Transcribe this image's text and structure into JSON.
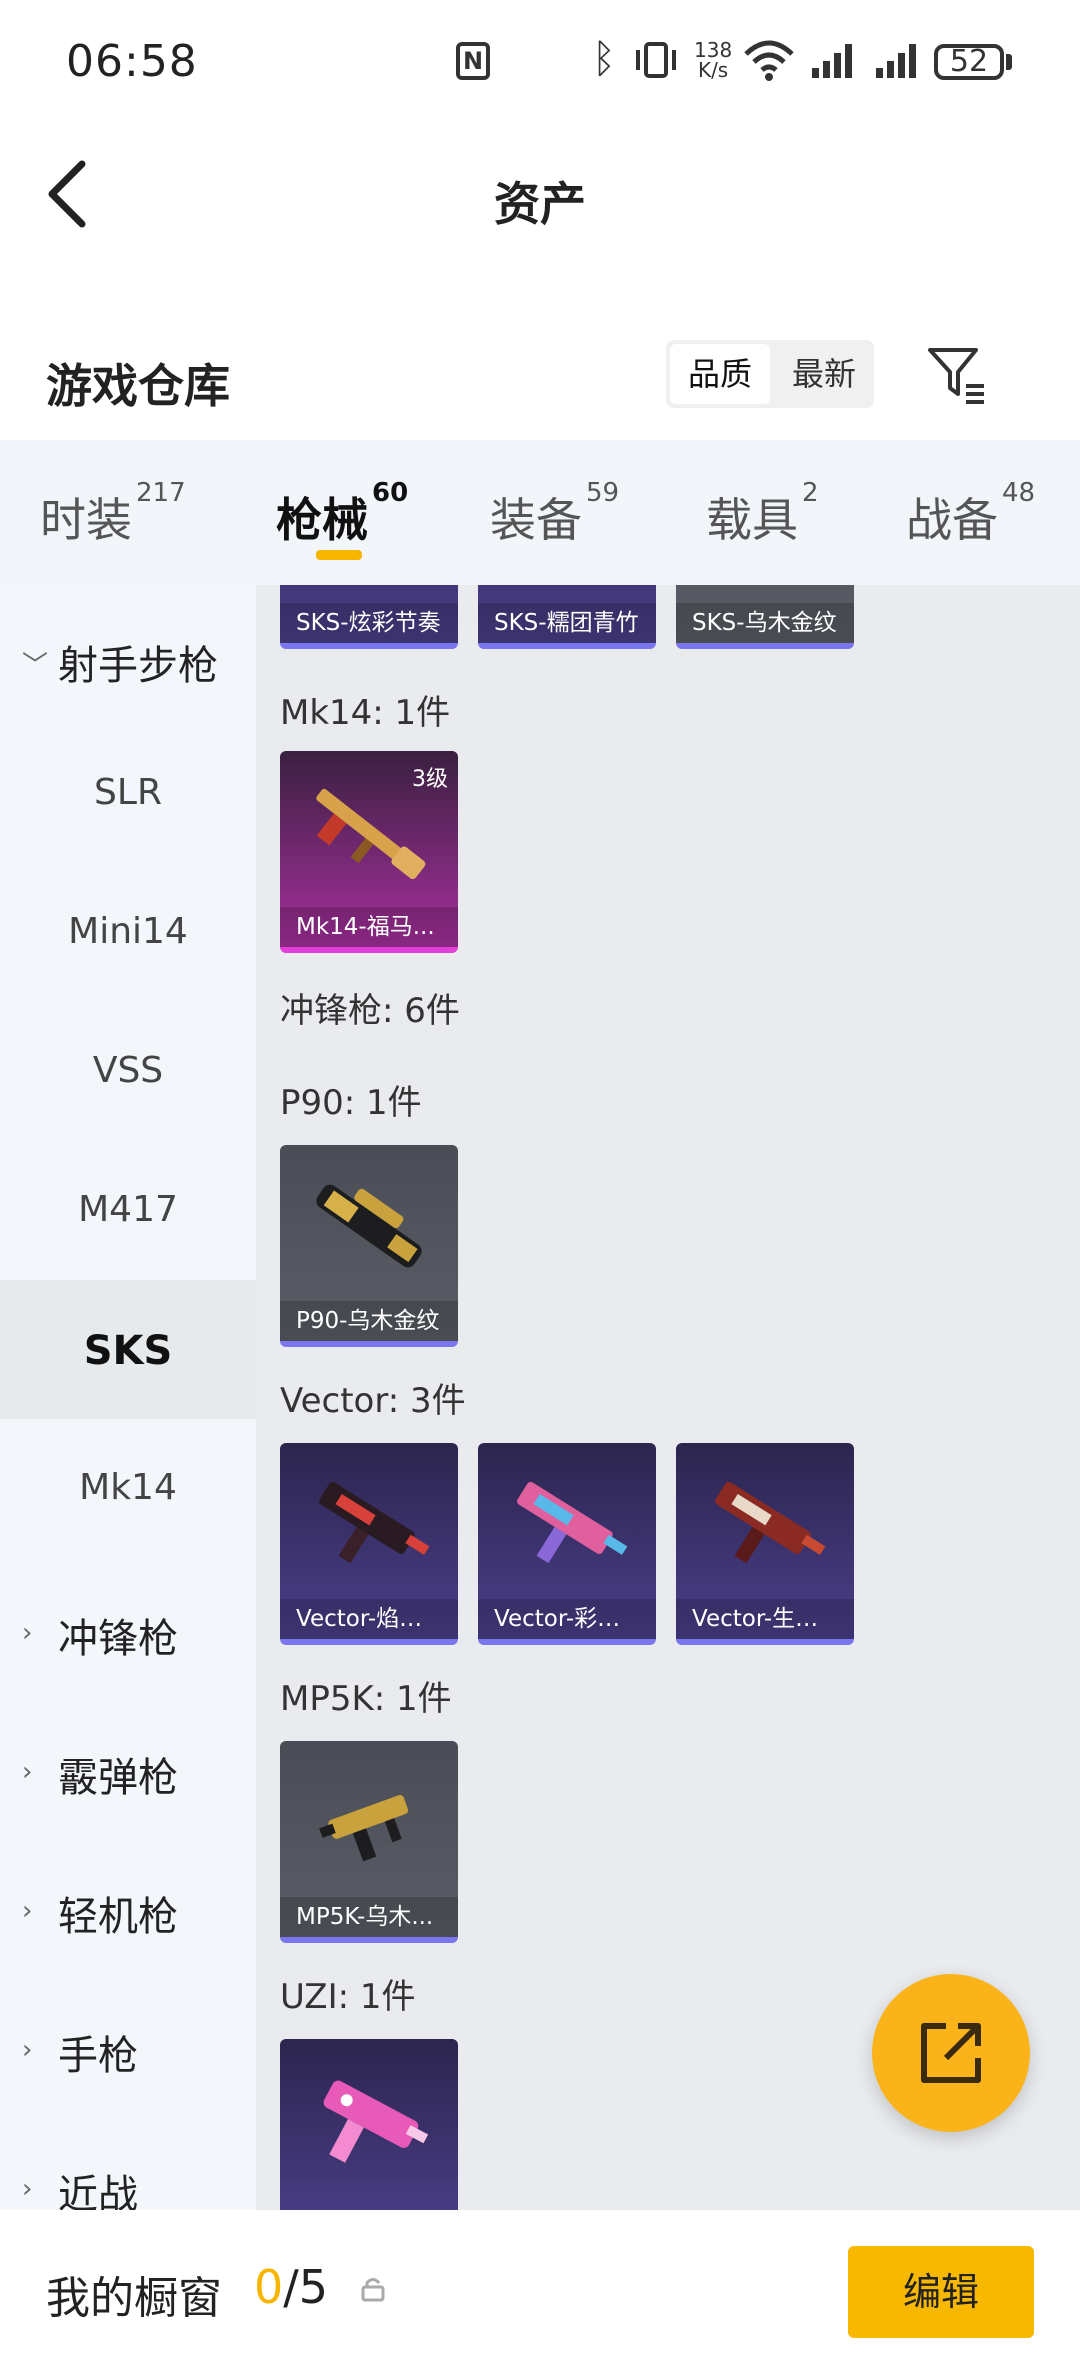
{
  "status_bar": {
    "time": "06:58",
    "nfc": "N",
    "net_speed_value": "138",
    "net_speed_unit": "K/s",
    "battery": "52"
  },
  "nav": {
    "title": "资产"
  },
  "section": {
    "title": "游戏仓库",
    "sort_options": [
      "品质",
      "最新"
    ],
    "sort_selected": "品质"
  },
  "tabs": [
    {
      "label": "时装",
      "count": "217"
    },
    {
      "label": "枪械",
      "count": "60",
      "active": true
    },
    {
      "label": "装备",
      "count": "59"
    },
    {
      "label": "载具",
      "count": "2"
    },
    {
      "label": "战备",
      "count": "48"
    }
  ],
  "sidebar": {
    "items": [
      {
        "label": "射手步枪",
        "type": "category",
        "expanded": true
      },
      {
        "label": "SLR"
      },
      {
        "label": "Mini14"
      },
      {
        "label": "VSS"
      },
      {
        "label": "M417"
      },
      {
        "label": "SKS",
        "active": true
      },
      {
        "label": "Mk14"
      },
      {
        "label": "冲锋枪",
        "type": "category"
      },
      {
        "label": "霰弹枪",
        "type": "category"
      },
      {
        "label": "轻机枪",
        "type": "category"
      },
      {
        "label": "手枪",
        "type": "category"
      },
      {
        "label": "近战",
        "type": "category"
      }
    ]
  },
  "content": {
    "sks_cards": [
      "SKS-炫彩节奏",
      "SKS-糯团青竹",
      "SKS-乌木金纹"
    ],
    "mk14_header": "Mk14: 1件",
    "mk14_cards": [
      {
        "name": "Mk14-福马...",
        "level": "3级"
      }
    ],
    "smg_header": "冲锋枪: 6件",
    "p90_header": "P90: 1件",
    "p90_cards": [
      "P90-乌木金纹"
    ],
    "vector_header": "Vector: 3件",
    "vector_cards": [
      "Vector-焰鹰...",
      "Vector-彩虹...",
      "Vector-生命..."
    ],
    "mp5k_header": "MP5K: 1件",
    "mp5k_cards": [
      "MP5K-乌木..."
    ],
    "uzi_header": "UZI: 1件"
  },
  "bottom_bar": {
    "label": "我的橱窗",
    "current": "0",
    "total": "/5",
    "edit_button": "编辑"
  },
  "colors": {
    "accent": "#f7b500",
    "card_purple_border": "#7a76ee",
    "card_pink_border": "#e040d8"
  }
}
